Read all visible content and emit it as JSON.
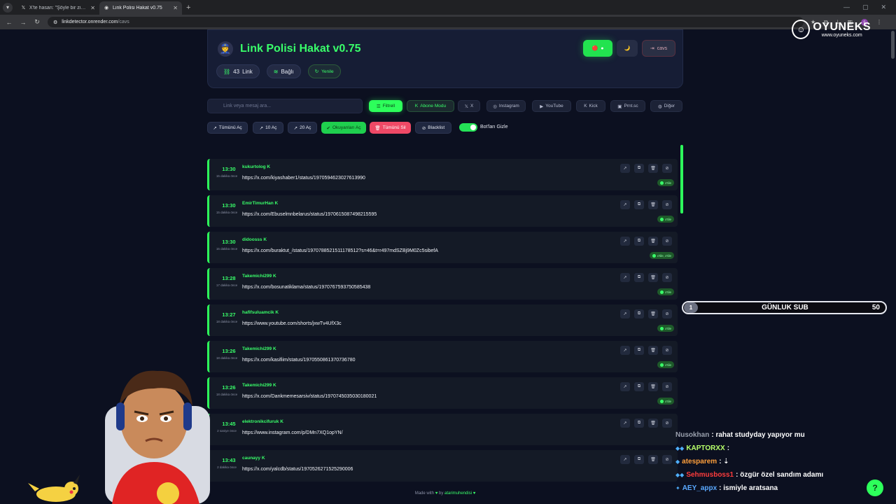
{
  "browser": {
    "tabs": [
      {
        "icon": "x-icon",
        "title": "X'te hasan: \"Şöyle bir zihniyete"
      },
      {
        "icon": "page-icon",
        "title": "Link Polisi Hakat v0.75"
      }
    ],
    "url_host": "linkdetector.onrender.com",
    "url_path": "/cavs"
  },
  "overlay_brand": {
    "name": "OYUNEKS",
    "site": "www.oyuneks.com"
  },
  "app": {
    "title": "Link Polisi Hakat v0.75",
    "logout_label": "cavs",
    "stats": {
      "link_count": "43",
      "link_label": "Link",
      "connection": "Bağlı",
      "refresh": "Yenile"
    }
  },
  "filters": {
    "search_placeholder": "Link veya mesaj ara...",
    "buttons": [
      {
        "label": "Filtrell",
        "active": true
      },
      {
        "label": "Abone Modu"
      },
      {
        "label": "X"
      },
      {
        "label": "Instagram"
      },
      {
        "label": "YouTube"
      },
      {
        "label": "Kick"
      },
      {
        "label": "Prnt.sc"
      },
      {
        "label": "Diğer"
      }
    ]
  },
  "actions": {
    "open_all": "Tümünü Aç",
    "open_10": "10 Aç",
    "open_20": "20 Aç",
    "open_read": "Okuyanları Aç",
    "delete_all": "Tümünü Sil",
    "blacklist": "Blacklist",
    "hide_bots": "Bot'ları Gizle",
    "hide_bots_on": true
  },
  "links": [
    {
      "time": "13:30",
      "ago": "15 dakika önce",
      "user": "kukurtolog",
      "url": "https://x.com/kiyashaber1/status/1970594623027613990",
      "badge": "x'tile"
    },
    {
      "time": "13:30",
      "ago": "15 dakika önce",
      "user": "EmirTimurHan",
      "url": "https://x.com/Ebuselmnbelarus/status/1970615087498215595",
      "badge": "x'tile"
    },
    {
      "time": "13:30",
      "ago": "15 dakika önce",
      "user": "didoosss",
      "url": "https://x.com/buraktut_/status/1970788521511178512?s=46&t=r497mdSZBj9M0Zc5sibefA",
      "badge": "x'tile, x'tile"
    },
    {
      "time": "13:28",
      "ago": "17 dakika önce",
      "user": "Takemichi299",
      "url": "https://x.com/bosunatiklama/status/1970767593750585438",
      "badge": "x'tile"
    },
    {
      "time": "13:27",
      "ago": "18 dakika önce",
      "user": "hafifsuluamcik",
      "url": "https://www.youtube.com/shorts/jxwTv4UfX3c",
      "badge": "x'tile"
    },
    {
      "time": "13:26",
      "ago": "18 dakika önce",
      "user": "Takemichi299",
      "url": "https://x.com/kasifiim/status/1970550861370736780",
      "badge": "x'tile"
    },
    {
      "time": "13:26",
      "ago": "18 dakika önce",
      "user": "Takemichi299",
      "url": "https://x.com/Dankmemesarsiv/status/1970745035030180021",
      "badge": "x'tile"
    },
    {
      "time": "13:45",
      "ago": "2 saniye önce",
      "user": "elektronikcifuruk",
      "url": "https://www.instagram.com/p/DMn7XQ1opYN/",
      "badge": ""
    },
    {
      "time": "13:43",
      "ago": "2 dakika önce",
      "user": "caunayy",
      "url": "https://x.com/yalcdb/status/1970526271525290006",
      "badge": ""
    }
  ],
  "footer": {
    "made_with": "Made with",
    "by": "by",
    "author": "atarimuhendisi"
  },
  "sub_goal": {
    "current": "1",
    "label": "GÜNLUK SUB",
    "target": "50"
  },
  "chat": [
    {
      "user": "Nusokhan",
      "color": "#9aa0ad",
      "message": ": rahat studyday yapıyor mu",
      "badges": ""
    },
    {
      "user": "KAPTORXX",
      "color": "#b7ff6a",
      "message": ":",
      "badges": "◆◆"
    },
    {
      "user": "atesparem",
      "color": "#ff9f3c",
      "message": ": ⇣",
      "badges": "◆"
    },
    {
      "user": "Sehmusboss1",
      "color": "#ff3c3c",
      "message": ": özgür özel sandım adamı",
      "badges": "◆◆"
    },
    {
      "user": "AEY_appx",
      "color": "#5aa9ff",
      "message": ": ismiyle aratsana",
      "badges": "✦"
    }
  ],
  "colors": {
    "accent": "#2dff5b",
    "danger": "#ef4966",
    "background": "#0c1020",
    "card": "#141a26"
  }
}
